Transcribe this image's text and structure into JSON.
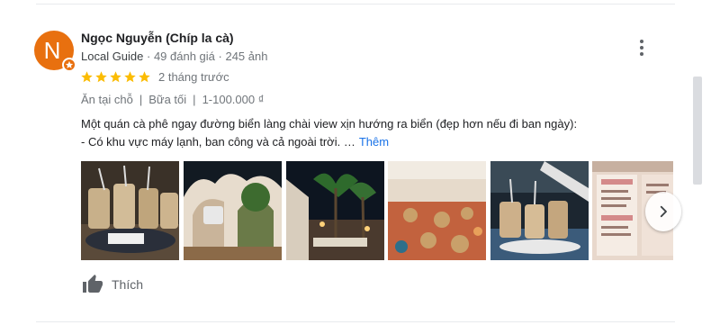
{
  "review": {
    "avatar_letter": "N",
    "reviewer_name": "Ngọc Nguyễn (Chíp la cà)",
    "local_guide": "Local Guide",
    "review_count": "49 đánh giá",
    "photo_count": "245 ảnh",
    "meta_sep": " · ",
    "rating": 5,
    "rating_max": 5,
    "time_ago": "2 tháng trước",
    "tags": [
      "Ăn tại chỗ",
      "Bữa tối",
      "1-100.000 ₫"
    ],
    "tag_sep": "|",
    "text_line1": "Một quán cà phê ngay đường biển làng chài view xịn hướng ra biển (đẹp hơn nếu đi ban ngày):",
    "text_line2": "- Có khu vực máy lạnh, ban công và cả ngoài trời. …",
    "more_link": "Thêm",
    "like_label": "Thích"
  },
  "colors": {
    "avatar": "#e8700f",
    "star": "#fbbc04",
    "link": "#1a73e8",
    "muted": "#70757a"
  },
  "icons": {
    "more": "more-vert-icon",
    "star": "star-icon",
    "next": "chevron-right-icon",
    "like": "thumb-up-icon",
    "badge": "local-guide-star-icon"
  }
}
